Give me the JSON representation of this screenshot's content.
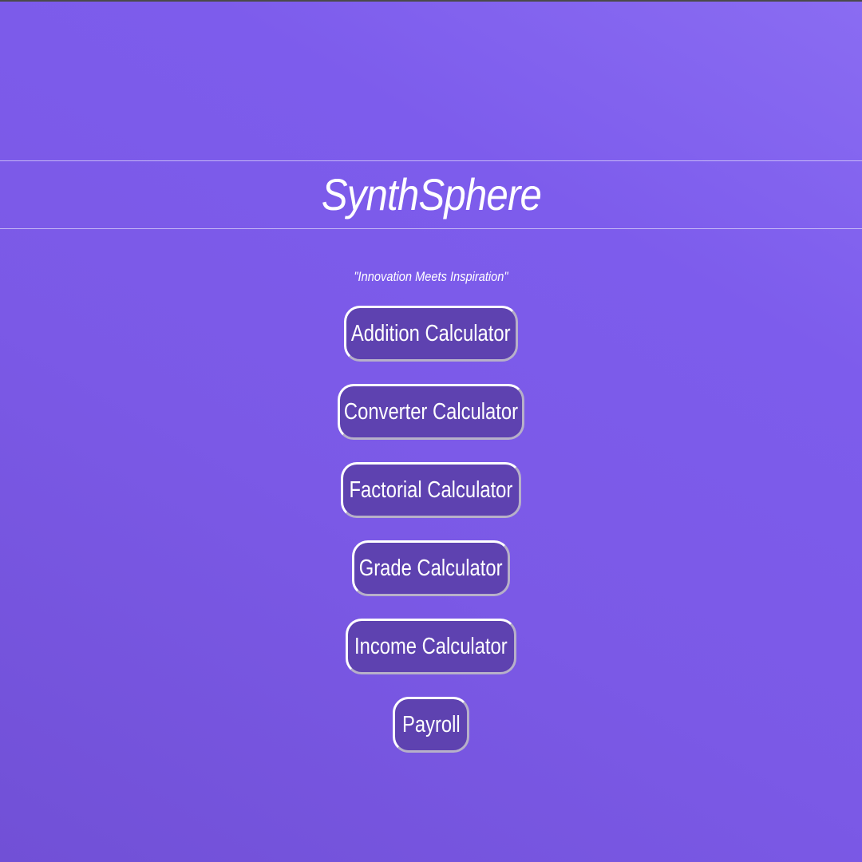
{
  "header": {
    "title": "SynthSphere",
    "tagline": "\"Innovation Meets Inspiration\""
  },
  "menu": {
    "items": [
      {
        "label": "Addition Calculator"
      },
      {
        "label": "Converter Calculator"
      },
      {
        "label": "Factorial Calculator"
      },
      {
        "label": "Grade Calculator"
      },
      {
        "label": "Income Calculator"
      },
      {
        "label": "Payroll"
      }
    ]
  },
  "colors": {
    "background_light": "#8a6cf2",
    "background_dark": "#7150d6",
    "button_fill": "#5e42b0",
    "button_border": "#ffffff",
    "text": "#ffffff"
  }
}
